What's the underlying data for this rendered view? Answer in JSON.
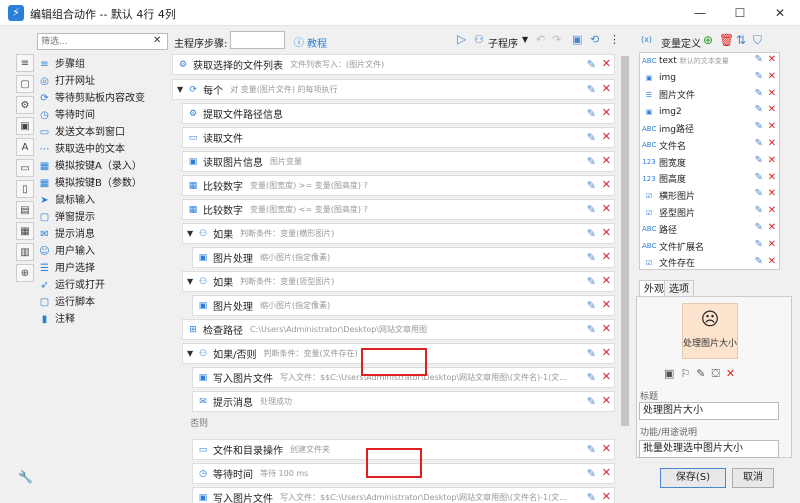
{
  "window": {
    "title": "编辑组合动作 -- 默认 4行 4列",
    "min": "—",
    "max": "☐",
    "close": "✕"
  },
  "left": {
    "search_placeholder": "筛选...",
    "items": [
      {
        "icon": "≡",
        "label": "步骤组"
      },
      {
        "icon": "◎",
        "label": "打开网址"
      },
      {
        "icon": "⟳",
        "label": "等待剪贴板内容改变"
      },
      {
        "icon": "◷",
        "label": "等待时间"
      },
      {
        "icon": "▭",
        "label": "发送文本到窗口"
      },
      {
        "icon": "⋯",
        "label": "获取选中的文本"
      },
      {
        "icon": "▦",
        "label": "模拟按键A（录入）"
      },
      {
        "icon": "▦",
        "label": "模拟按键B（参数）"
      },
      {
        "icon": "➤",
        "label": "鼠标输入"
      },
      {
        "icon": "▢",
        "label": "弹窗提示"
      },
      {
        "icon": "✉",
        "label": "提示消息"
      },
      {
        "icon": "☺",
        "label": "用户输入"
      },
      {
        "icon": "☰",
        "label": "用户选择"
      },
      {
        "icon": "➶",
        "label": "运行或打开"
      },
      {
        "icon": "▢",
        "label": "运行脚本"
      },
      {
        "icon": "▮",
        "label": "注释"
      }
    ],
    "toolbar": [
      "≡",
      "▢",
      "⚙",
      "▣",
      "A",
      "▭",
      "▯",
      "▤",
      "▦",
      "▥",
      "⊕"
    ]
  },
  "main": {
    "label": "主程序步骤:",
    "tutorial": "教程",
    "subprogram": "子程序",
    "else_label": "否则",
    "steps": [
      {
        "name": "获取选择的文件列表",
        "desc": "文件列表写入：(图片文件)"
      },
      {
        "name": "每个",
        "desc": "对 变量(图片文件) 的每项执行"
      },
      {
        "name": "提取文件路径信息",
        "desc": ""
      },
      {
        "name": "读取文件",
        "desc": ""
      },
      {
        "name": "读取图片信息",
        "desc": "图片变量"
      },
      {
        "name": "比较数字",
        "desc": "变量(图宽度) >= 变量(图高度) ?"
      },
      {
        "name": "比较数字",
        "desc": "变量(图宽度) <= 变量(图高度) ?"
      },
      {
        "name": "如果",
        "desc": "判断条件：变量(横形图片)"
      },
      {
        "name": "图片处理",
        "desc": "缩小图片(指定像素)"
      },
      {
        "name": "如果",
        "desc": "判断条件：变量(竖型图片)"
      },
      {
        "name": "图片处理",
        "desc": "缩小图片(指定像素)"
      },
      {
        "name": "检查路径",
        "desc": "C:\\Users\\Administrator\\Desktop\\网站文章用图"
      },
      {
        "name": "如果/否则",
        "desc": "判断条件：变量(文件存在)"
      },
      {
        "name": "写入图片文件",
        "desc": "写入文件：$$C:\\Users\\Administrator\\Desktop\\网站文章用图\\(文件名)-1(文..."
      },
      {
        "name": "提示消息",
        "desc": "处理成功"
      },
      {
        "name": "文件和目录操作",
        "desc": "创建文件夹"
      },
      {
        "name": "等待时间",
        "desc": "等待 100 ms"
      },
      {
        "name": "写入图片文件",
        "desc": "写入文件：$$C:\\Users\\Administrator\\Desktop\\网站文章用图\\(文件名)-1(文..."
      }
    ]
  },
  "vars": {
    "title": "变量定义",
    "items": [
      {
        "type": "ABC",
        "name": "text",
        "desc": "默认的文本变量"
      },
      {
        "type": "▣",
        "name": "img",
        "desc": ""
      },
      {
        "type": "☰",
        "name": "图片文件",
        "desc": ""
      },
      {
        "type": "▣",
        "name": "img2",
        "desc": ""
      },
      {
        "type": "ABC",
        "name": "img路径",
        "desc": ""
      },
      {
        "type": "ABC",
        "name": "文件名",
        "desc": ""
      },
      {
        "type": "123",
        "name": "图宽度",
        "desc": ""
      },
      {
        "type": "123",
        "name": "图高度",
        "desc": ""
      },
      {
        "type": "☑",
        "name": "横形图片",
        "desc": ""
      },
      {
        "type": "☑",
        "name": "竖型图片",
        "desc": ""
      },
      {
        "type": "ABC",
        "name": "路径",
        "desc": ""
      },
      {
        "type": "ABC",
        "name": "文件扩展名",
        "desc": ""
      },
      {
        "type": "☑",
        "name": "文件存在",
        "desc": ""
      }
    ]
  },
  "props": {
    "tab1": "外观",
    "tab2": "选项",
    "preview_label": "处理图片大小",
    "title_label": "标题",
    "title_value": "处理图片大小",
    "desc_label": "功能/用途说明",
    "desc_value": "批量处理选中图片大小",
    "save": "保存(S)",
    "cancel": "取消"
  }
}
